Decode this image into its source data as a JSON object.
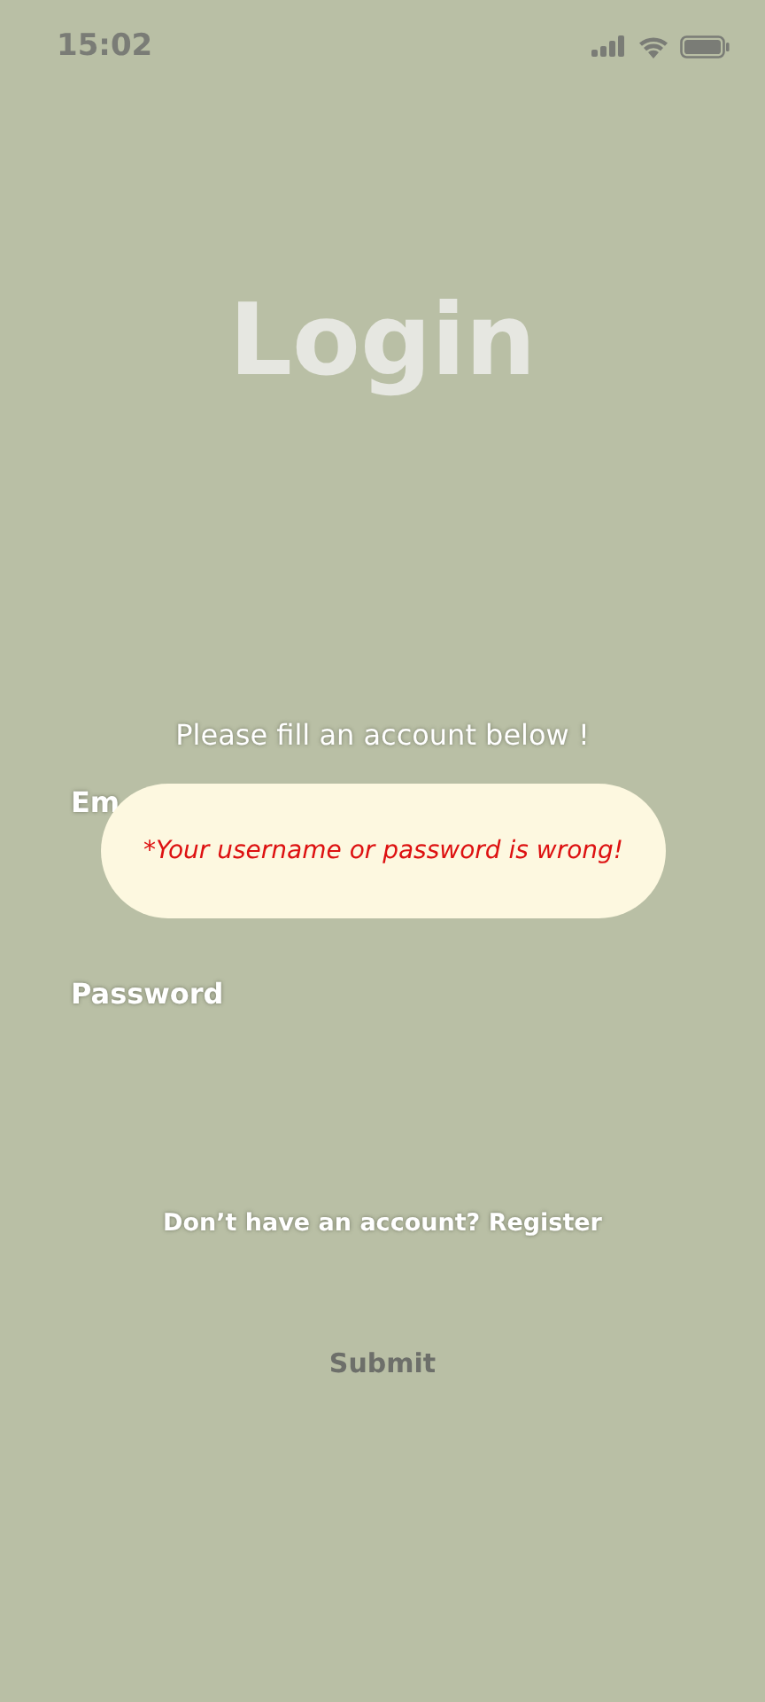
{
  "status_bar": {
    "time": "15:02"
  },
  "title": "Login",
  "subtitle": "Please fill an account below !",
  "fields": [
    {
      "label": "Em"
    },
    {
      "label": "Password"
    }
  ],
  "register_prompt": {
    "text": "Don’t have an account?",
    "link": "Register"
  },
  "submit_button": "Submit",
  "error_popup": {
    "message": "*Your username or password is wrong!"
  }
}
